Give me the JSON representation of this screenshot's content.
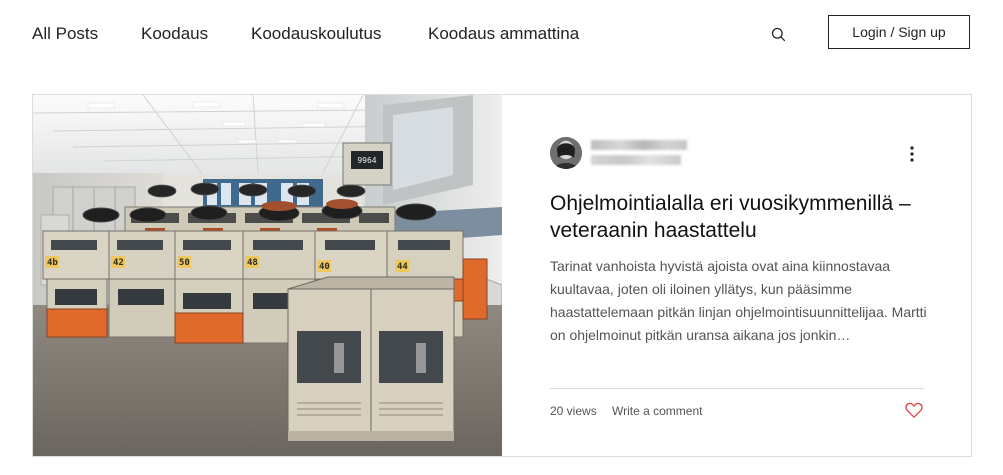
{
  "nav": {
    "items": [
      {
        "label": "All Posts"
      },
      {
        "label": "Koodaus"
      },
      {
        "label": "Koodauskoulutus"
      },
      {
        "label": "Koodaus ammattina"
      }
    ],
    "search_icon": "search-icon",
    "login_label": "Login / Sign up"
  },
  "post": {
    "author": "",
    "meta": "",
    "title": "Ohjelmointialalla eri vuosikymmenillä – veteraanin haastattelu",
    "excerpt": "Tarinat vanhoista hyvistä ajoista ovat aina kiinnostavaa kuultavaa, joten oli iloinen yllätys, kun pääsimme haastattelemaan pitkän linjan ohjelmointisuunnittelijaa. Martti on ohjelmoinut pitkän uransa aikana jos jonkin…",
    "views": "20 views",
    "comment_label": "Write a comment",
    "more_icon": "more-options-icon",
    "like_icon": "heart-icon"
  },
  "colors": {
    "text": "#222222",
    "excerpt": "#545454",
    "border": "#dcdcdc",
    "heart": "#e04848",
    "cover_orange": "#df6a2c",
    "cover_beige": "#d7d0bf",
    "cover_panel": "#43484d"
  },
  "cover": {
    "subject": "vintage mainframe computer room",
    "unit_labels": [
      "4b",
      "42",
      "50",
      "48",
      "40",
      "44"
    ]
  }
}
